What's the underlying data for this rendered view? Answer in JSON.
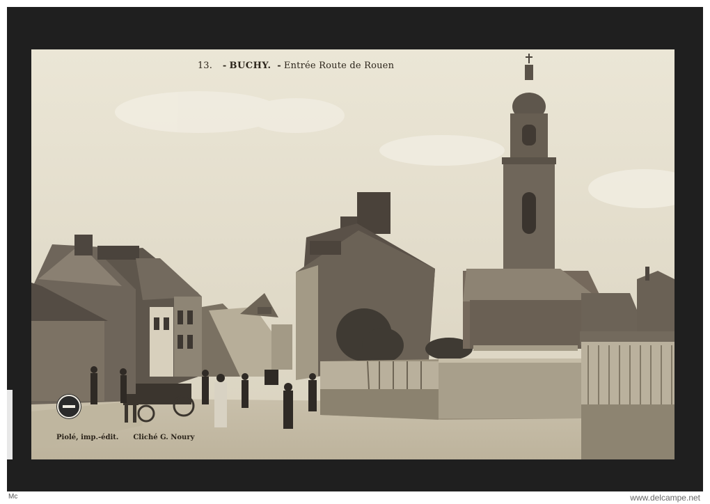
{
  "postcard": {
    "number": "13.",
    "place": "BUCHY.",
    "separator": "-",
    "description": "Entrée Route de Rouen",
    "publisher": "Piolé, imp.-édit.",
    "photographer": "Cliché G. Noury"
  },
  "footer": {
    "mark": "Mc",
    "watermark": "www.delcampe.net"
  }
}
